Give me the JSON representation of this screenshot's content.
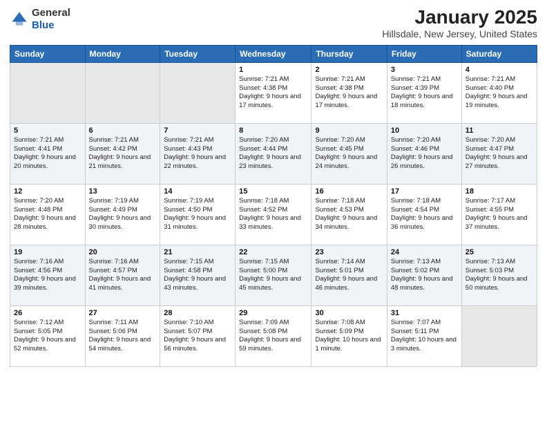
{
  "logo": {
    "general": "General",
    "blue": "Blue"
  },
  "header": {
    "title": "January 2025",
    "subtitle": "Hillsdale, New Jersey, United States"
  },
  "weekdays": [
    "Sunday",
    "Monday",
    "Tuesday",
    "Wednesday",
    "Thursday",
    "Friday",
    "Saturday"
  ],
  "weeks": [
    [
      {
        "day": "",
        "empty": true
      },
      {
        "day": "",
        "empty": true
      },
      {
        "day": "",
        "empty": true
      },
      {
        "day": "1",
        "sunrise": "7:21 AM",
        "sunset": "4:38 PM",
        "daylight": "9 hours and 17 minutes."
      },
      {
        "day": "2",
        "sunrise": "7:21 AM",
        "sunset": "4:38 PM",
        "daylight": "9 hours and 17 minutes."
      },
      {
        "day": "3",
        "sunrise": "7:21 AM",
        "sunset": "4:39 PM",
        "daylight": "9 hours and 18 minutes."
      },
      {
        "day": "4",
        "sunrise": "7:21 AM",
        "sunset": "4:40 PM",
        "daylight": "9 hours and 19 minutes."
      }
    ],
    [
      {
        "day": "5",
        "sunrise": "7:21 AM",
        "sunset": "4:41 PM",
        "daylight": "9 hours and 20 minutes."
      },
      {
        "day": "6",
        "sunrise": "7:21 AM",
        "sunset": "4:42 PM",
        "daylight": "9 hours and 21 minutes."
      },
      {
        "day": "7",
        "sunrise": "7:21 AM",
        "sunset": "4:43 PM",
        "daylight": "9 hours and 22 minutes."
      },
      {
        "day": "8",
        "sunrise": "7:20 AM",
        "sunset": "4:44 PM",
        "daylight": "9 hours and 23 minutes."
      },
      {
        "day": "9",
        "sunrise": "7:20 AM",
        "sunset": "4:45 PM",
        "daylight": "9 hours and 24 minutes."
      },
      {
        "day": "10",
        "sunrise": "7:20 AM",
        "sunset": "4:46 PM",
        "daylight": "9 hours and 26 minutes."
      },
      {
        "day": "11",
        "sunrise": "7:20 AM",
        "sunset": "4:47 PM",
        "daylight": "9 hours and 27 minutes."
      }
    ],
    [
      {
        "day": "12",
        "sunrise": "7:20 AM",
        "sunset": "4:48 PM",
        "daylight": "9 hours and 28 minutes."
      },
      {
        "day": "13",
        "sunrise": "7:19 AM",
        "sunset": "4:49 PM",
        "daylight": "9 hours and 30 minutes."
      },
      {
        "day": "14",
        "sunrise": "7:19 AM",
        "sunset": "4:50 PM",
        "daylight": "9 hours and 31 minutes."
      },
      {
        "day": "15",
        "sunrise": "7:18 AM",
        "sunset": "4:52 PM",
        "daylight": "9 hours and 33 minutes."
      },
      {
        "day": "16",
        "sunrise": "7:18 AM",
        "sunset": "4:53 PM",
        "daylight": "9 hours and 34 minutes."
      },
      {
        "day": "17",
        "sunrise": "7:18 AM",
        "sunset": "4:54 PM",
        "daylight": "9 hours and 36 minutes."
      },
      {
        "day": "18",
        "sunrise": "7:17 AM",
        "sunset": "4:55 PM",
        "daylight": "9 hours and 37 minutes."
      }
    ],
    [
      {
        "day": "19",
        "sunrise": "7:16 AM",
        "sunset": "4:56 PM",
        "daylight": "9 hours and 39 minutes."
      },
      {
        "day": "20",
        "sunrise": "7:16 AM",
        "sunset": "4:57 PM",
        "daylight": "9 hours and 41 minutes."
      },
      {
        "day": "21",
        "sunrise": "7:15 AM",
        "sunset": "4:58 PM",
        "daylight": "9 hours and 43 minutes."
      },
      {
        "day": "22",
        "sunrise": "7:15 AM",
        "sunset": "5:00 PM",
        "daylight": "9 hours and 45 minutes."
      },
      {
        "day": "23",
        "sunrise": "7:14 AM",
        "sunset": "5:01 PM",
        "daylight": "9 hours and 46 minutes."
      },
      {
        "day": "24",
        "sunrise": "7:13 AM",
        "sunset": "5:02 PM",
        "daylight": "9 hours and 48 minutes."
      },
      {
        "day": "25",
        "sunrise": "7:13 AM",
        "sunset": "5:03 PM",
        "daylight": "9 hours and 50 minutes."
      }
    ],
    [
      {
        "day": "26",
        "sunrise": "7:12 AM",
        "sunset": "5:05 PM",
        "daylight": "9 hours and 52 minutes."
      },
      {
        "day": "27",
        "sunrise": "7:11 AM",
        "sunset": "5:06 PM",
        "daylight": "9 hours and 54 minutes."
      },
      {
        "day": "28",
        "sunrise": "7:10 AM",
        "sunset": "5:07 PM",
        "daylight": "9 hours and 56 minutes."
      },
      {
        "day": "29",
        "sunrise": "7:09 AM",
        "sunset": "5:08 PM",
        "daylight": "9 hours and 59 minutes."
      },
      {
        "day": "30",
        "sunrise": "7:08 AM",
        "sunset": "5:09 PM",
        "daylight": "10 hours and 1 minute."
      },
      {
        "day": "31",
        "sunrise": "7:07 AM",
        "sunset": "5:11 PM",
        "daylight": "10 hours and 3 minutes."
      },
      {
        "day": "",
        "empty": true
      }
    ]
  ]
}
